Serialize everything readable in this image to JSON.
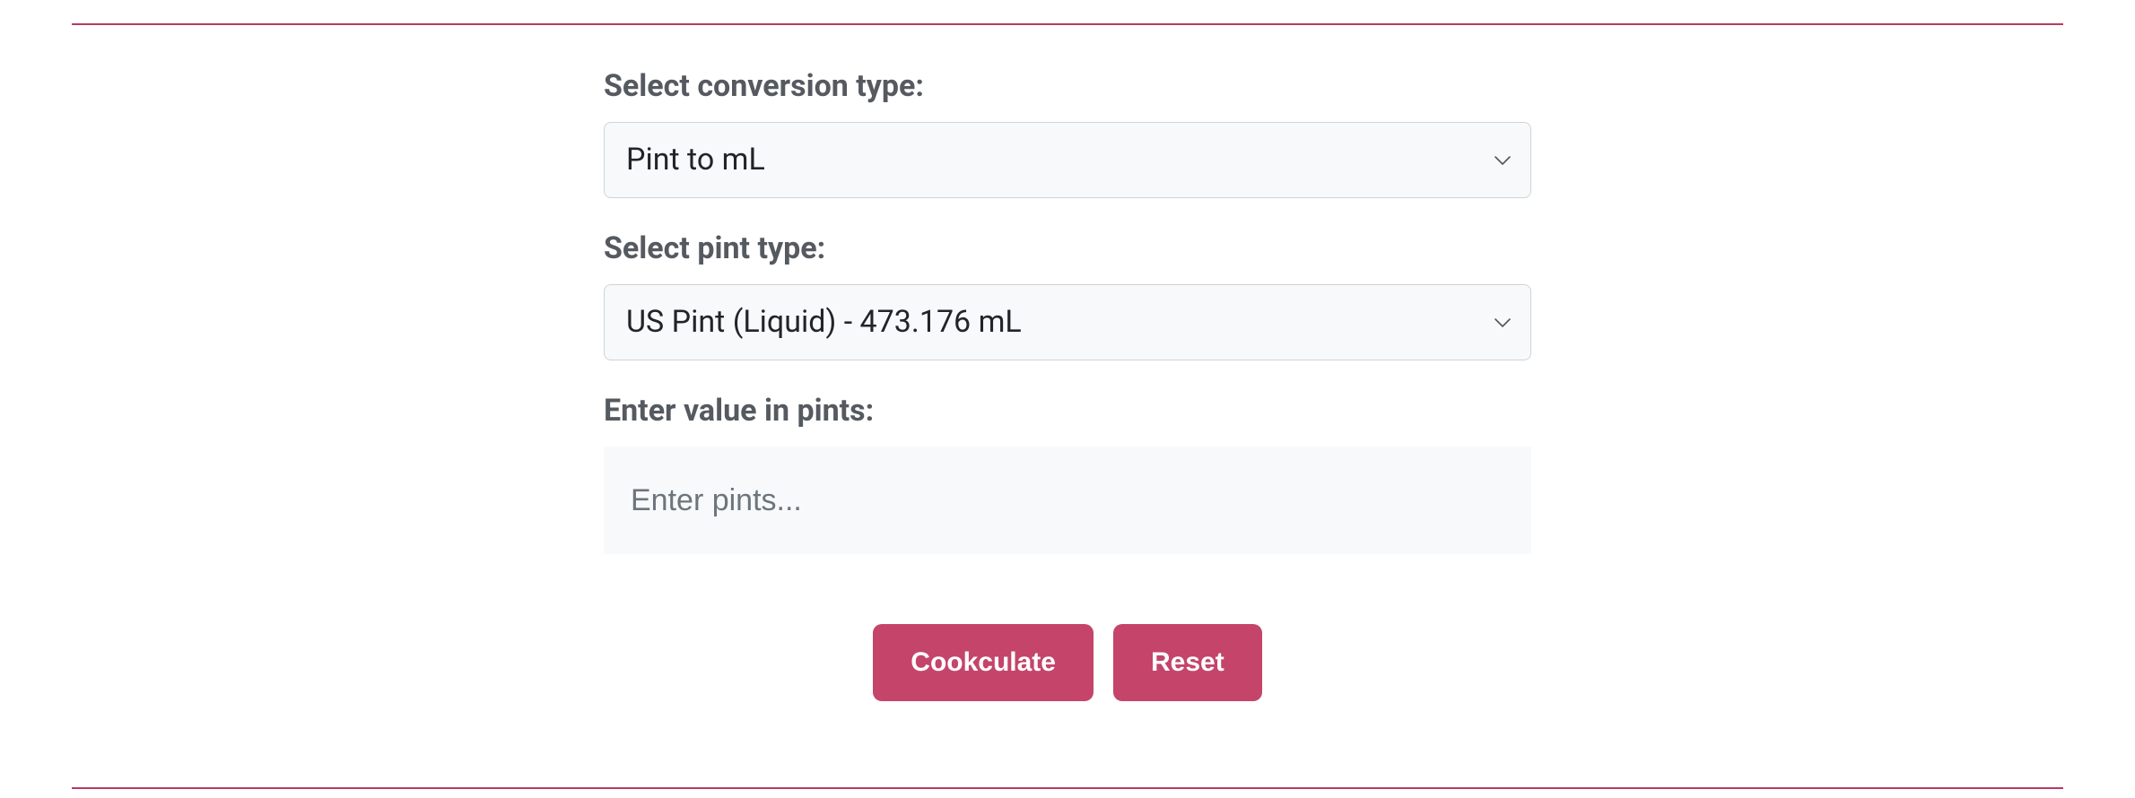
{
  "colors": {
    "accent": "#c44569",
    "rule": "#b83b5e"
  },
  "form": {
    "conversion": {
      "label": "Select conversion type:",
      "selected": "Pint to mL"
    },
    "pint_type": {
      "label": "Select pint type:",
      "selected": "US Pint (Liquid) - 473.176 mL"
    },
    "value": {
      "label": "Enter value in pints:",
      "placeholder": "Enter pints...",
      "value": ""
    }
  },
  "buttons": {
    "submit": "Cookculate",
    "reset": "Reset"
  }
}
